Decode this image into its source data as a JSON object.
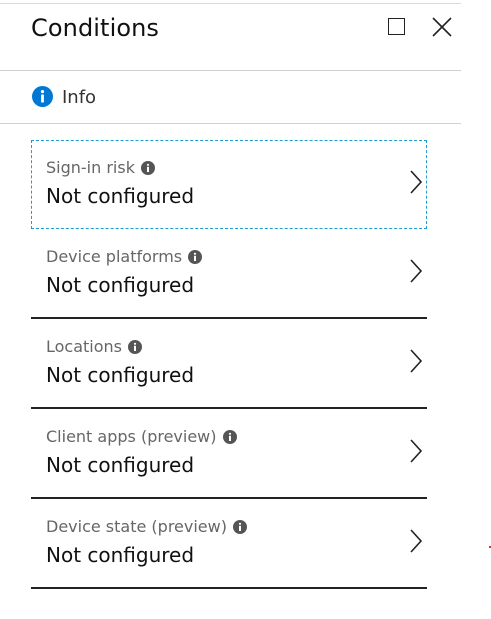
{
  "panel": {
    "title": "Conditions",
    "maximize_icon": "maximize-icon",
    "close_icon": "close-icon"
  },
  "infobar": {
    "label": "Info",
    "icon": "info-icon",
    "icon_color": "#0078d4"
  },
  "conditions": [
    {
      "label": "Sign-in risk",
      "value": "Not configured",
      "selected": true
    },
    {
      "label": "Device platforms",
      "value": "Not configured",
      "selected": false
    },
    {
      "label": "Locations",
      "value": "Not configured",
      "selected": false
    },
    {
      "label": "Client apps (preview)",
      "value": "Not configured",
      "selected": false
    },
    {
      "label": "Device state (preview)",
      "value": "Not configured",
      "selected": false
    }
  ],
  "colors": {
    "selection_outline": "#1e9ecf",
    "divider": "#222222",
    "label_text": "#666666"
  }
}
